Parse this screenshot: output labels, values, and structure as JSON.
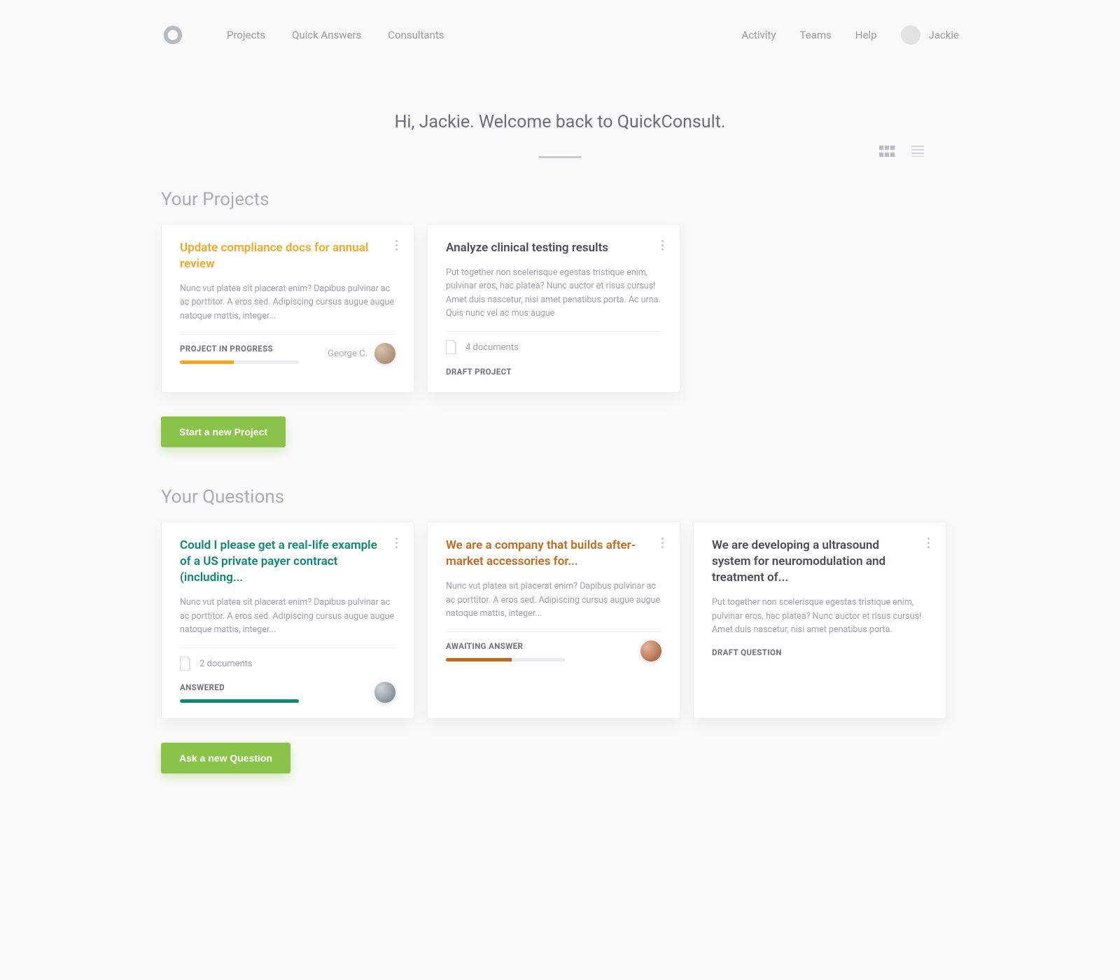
{
  "nav": {
    "left": [
      "Projects",
      "Quick Answers",
      "Consultants"
    ],
    "right": [
      "Activity",
      "Teams",
      "Help"
    ],
    "user": "Jackie"
  },
  "welcome": "Hi, Jackie. Welcome back to QuickConsult.",
  "projects": {
    "title": "Your Projects",
    "button": "Start a new Project",
    "items": [
      {
        "title": "Update compliance docs for annual review",
        "desc": "Nunc vut platea sit placerat enim? Dapibus pulvinar ac ac porttitor. A eros sed. Adipiscing cursus augue augue natoque mattis, integer...",
        "status": "PROJECT IN PROGRESS",
        "progress": 45,
        "assignee": "George C."
      },
      {
        "title": "Analyze clinical testing results",
        "desc": "Put together non scelerisque egestas tristique enim, pulvinar eros, hac platea? Nunc auctor et risus cursus! Amet duis nascetur, nisi amet penatibus porta. Ac urna. Quis nunc vel ac mus augue",
        "docs": "4 documents",
        "status": "DRAFT PROJECT"
      }
    ]
  },
  "questions": {
    "title": "Your Questions",
    "button": "Ask a new Question",
    "items": [
      {
        "title": "Could I please get a real-life example of a US private payer contract (including...",
        "desc": "Nunc vut platea sit placerat enim? Dapibus pulvinar ac ac porttitor. A eros sed. Adipiscing cursus augue augue natoque mattis, integer...",
        "docs": "2 documents",
        "status": "ANSWERED",
        "progress": 100
      },
      {
        "title": "We are a company that builds after-market accessories for...",
        "desc": "Nunc vut platea sit placerat enim? Dapibus pulvinar ac ac porttitor. A eros sed. Adipiscing cursus augue augue natoque mattis, integer...",
        "status": "AWAITING ANSWER",
        "progress": 50
      },
      {
        "title": "We are developing a ultrasound system for neuromodulation and treatment of...",
        "desc": "Put together non scelerisque egestas tristique enim, pulvinar eros, hac platea? Nunc auctor et risus cursus! Amet duis nascetur, nisi amet penatibus porta.",
        "status": "DRAFT QUESTION"
      }
    ]
  }
}
